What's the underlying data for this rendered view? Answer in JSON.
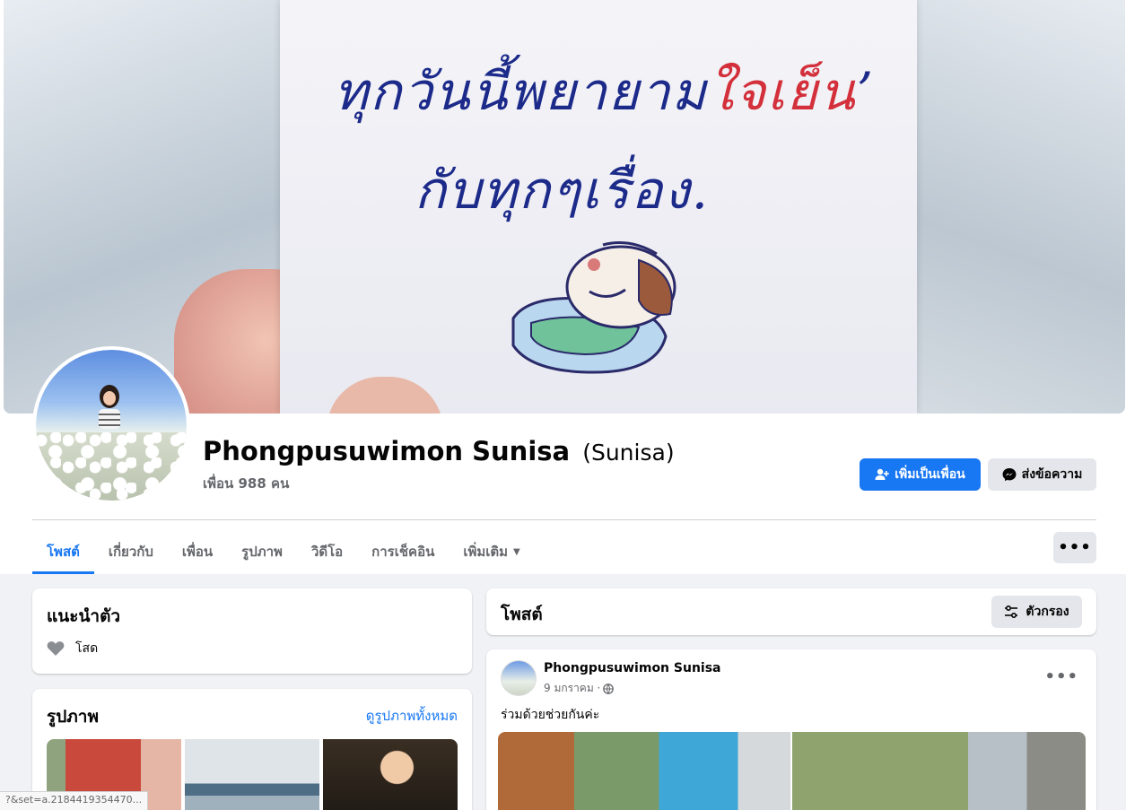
{
  "cover": {
    "text_line1_a": "ทุกวันนี้พยายาม",
    "text_line1_b": "ใจเย็น",
    "text_line1_c": "’",
    "text_line2": "กับทุกๆเรื่อง."
  },
  "profile": {
    "name": "Phongpusuwimon Sunisa",
    "alt_name": "(Sunisa)",
    "friends": "เพื่อน 988 คน"
  },
  "actions": {
    "add_friend": "เพิ่มเป็นเพื่อน",
    "message": "ส่งข้อความ",
    "more": "•••"
  },
  "tabs": [
    {
      "label": "โพสต์"
    },
    {
      "label": "เกี่ยวกับ"
    },
    {
      "label": "เพื่อน"
    },
    {
      "label": "รูปภาพ"
    },
    {
      "label": "วิดีโอ"
    },
    {
      "label": "การเช็คอิน"
    },
    {
      "label": "เพิ่มเติม"
    }
  ],
  "intro": {
    "title": "แนะนำตัว",
    "relationship": "โสด"
  },
  "photos": {
    "title": "รูปภาพ",
    "see_all": "ดูรูปภาพทั้งหมด"
  },
  "posts_header": {
    "title": "โพสต์",
    "filter": "ตัวกรอง"
  },
  "post": {
    "author": "Phongpusuwimon Sunisa",
    "date": "9 มกราคม ·",
    "text": "ร่วมด้วยช่วยกันค่ะ",
    "more": "•••"
  },
  "status_bar": {
    "url": "?&set=a.2184419354470..."
  },
  "colors": {
    "accent": "#1877f2",
    "background": "#f0f2f5",
    "button_gray": "#e4e6eb",
    "text_secondary": "#65676b"
  }
}
